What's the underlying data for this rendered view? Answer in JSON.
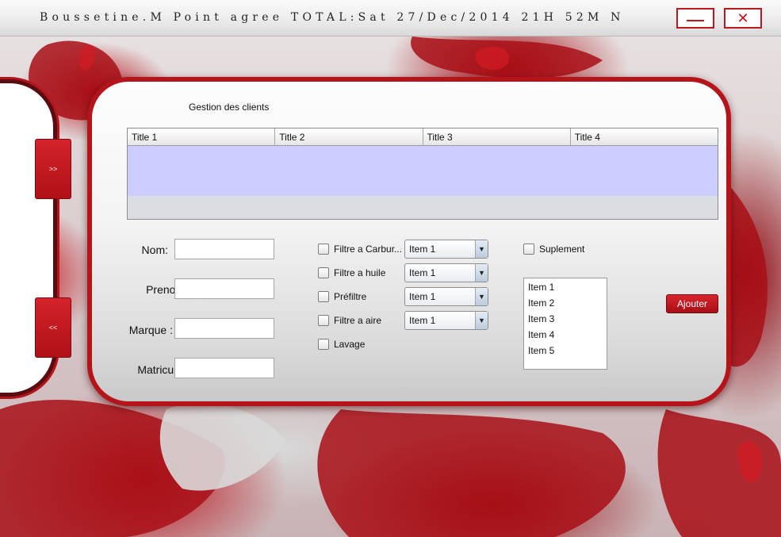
{
  "window": {
    "title": "Boussetine.M Point agree TOTAL:Sat 27/Dec/2014 21H 52M N",
    "minimize_glyph": "",
    "close_glyph": "✕"
  },
  "side": {
    "next_label": ">>",
    "prev_label": "<<"
  },
  "main": {
    "section_title": "Gestion des clients",
    "table": {
      "columns": [
        "Title 1",
        "Title 2",
        "Title 3",
        "Title 4"
      ]
    },
    "form": {
      "nom_label": "Nom:",
      "nom_value": "",
      "prenom_label": "Prenom:",
      "prenom_value": "",
      "marque_label": "Marque :",
      "marque_value": "",
      "matricule_label": "Matricule:",
      "matricule_value": ""
    },
    "options": [
      {
        "label": "Filtre a Carbur...",
        "combo": "Item 1"
      },
      {
        "label": "Filtre a huile",
        "combo": "Item 1"
      },
      {
        "label": "Préfiltre",
        "combo": "Item 1"
      },
      {
        "label": "Filtre a aire",
        "combo": "Item 1"
      },
      {
        "label": "Lavage"
      }
    ],
    "suplement_label": "Suplement",
    "list_items": [
      "Item 1",
      "Item 2",
      "Item 3",
      "Item 4",
      "Item 5"
    ],
    "add_button": "Ajouter"
  },
  "colors": {
    "accent_red": "#b5141b",
    "table_row": "#ccccff"
  }
}
